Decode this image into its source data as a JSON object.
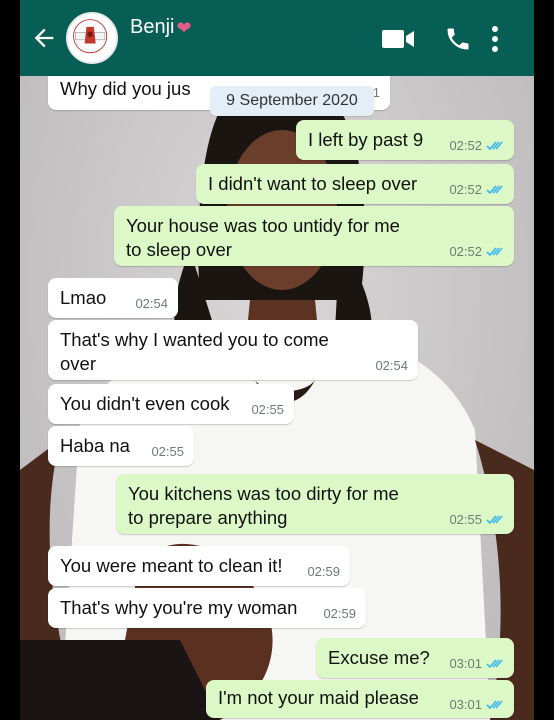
{
  "header": {
    "contact_name": "Benji",
    "colors": {
      "bar": "#075e54",
      "heart": "#e45c8a"
    },
    "icons": [
      "back-arrow-icon",
      "avatar",
      "video-call-icon",
      "voice-call-icon",
      "more-options-icon"
    ]
  },
  "date_chip": "9 September 2020",
  "messages": [
    {
      "dir": "in",
      "text": "Why did you jus",
      "time": "51"
    },
    {
      "dir": "out",
      "text": "I left by past 9",
      "time": "02:52"
    },
    {
      "dir": "out",
      "text": "I didn't want to sleep over",
      "time": "02:52"
    },
    {
      "dir": "out",
      "lines": [
        "Your house was too untidy for me",
        "to sleep over"
      ],
      "time": "02:52"
    },
    {
      "dir": "in",
      "text": "Lmao",
      "time": "02:54"
    },
    {
      "dir": "in",
      "lines": [
        "That's why I wanted you to come",
        "over"
      ],
      "time": "02:54"
    },
    {
      "dir": "in",
      "text": "You didn't even cook",
      "time": "02:55"
    },
    {
      "dir": "in",
      "text": "Haba na",
      "time": "02:55"
    },
    {
      "dir": "out",
      "lines": [
        "You kitchens was too dirty for me",
        "to prepare anything"
      ],
      "time": "02:55"
    },
    {
      "dir": "in",
      "text": "You were meant to clean it!",
      "time": "02:59"
    },
    {
      "dir": "in",
      "text": "That's why you're my woman",
      "time": "02:59"
    },
    {
      "dir": "out",
      "text": "Excuse me?",
      "time": "03:01"
    },
    {
      "dir": "out",
      "text": "I'm not your maid please",
      "time": "03:01"
    }
  ]
}
